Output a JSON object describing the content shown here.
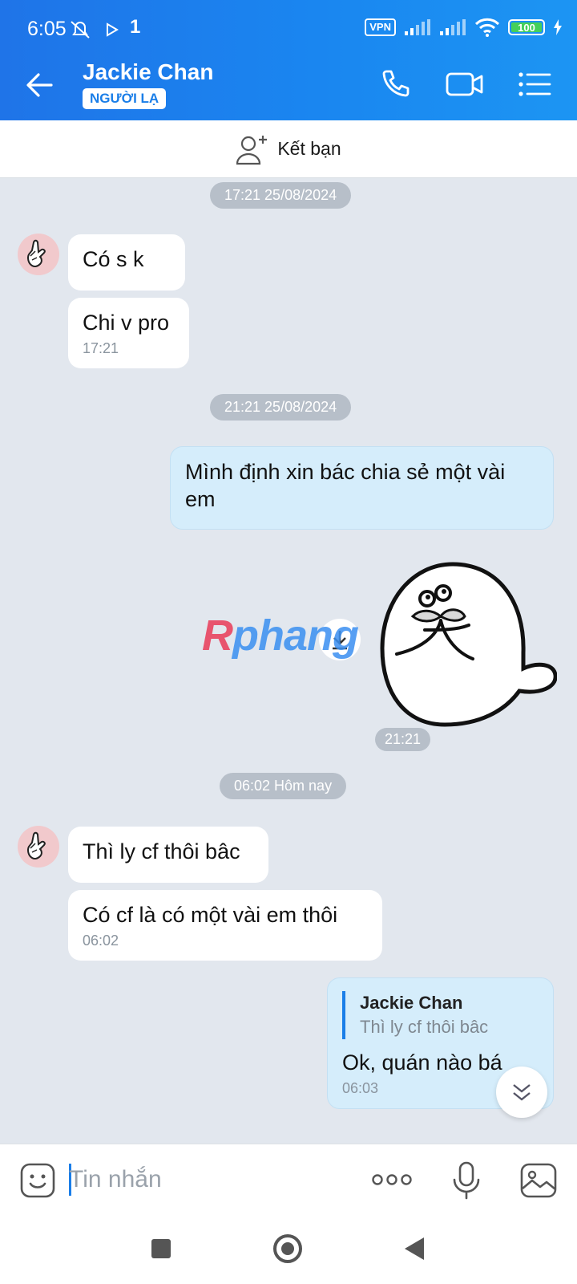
{
  "status_bar": {
    "time": "6:05",
    "extra": "1",
    "vpn": "VPN",
    "battery": "100"
  },
  "header": {
    "contact_name": "Jackie Chan",
    "badge": "NGƯỜI LẠ"
  },
  "add_friend": {
    "label": "Kết bạn"
  },
  "messages": {
    "pill1": "17:21 25/08/2024",
    "m1": "Có s k",
    "m2": "Chi v pro",
    "m2_time": "17:21",
    "pill2": "21:21 25/08/2024",
    "m3": "Mình định xin bác chia sẻ một vài em",
    "sticker_time": "21:21",
    "pill3": "06:02 Hôm nay",
    "m4": "Thì ly cf thôi bâc",
    "m5": "Có cf là có  một vài em thôi",
    "m5_time": "06:02",
    "m6_quote_name": "Jackie Chan",
    "m6_quote_text": "Thì ly cf thôi bâc",
    "m6": "Ok, quán nào bá",
    "m6_time": "06:03"
  },
  "watermark": {
    "r": "R",
    "rest": "phang"
  },
  "input": {
    "placeholder": "Tin nhắn"
  },
  "colors": {
    "accent": "#1a7ee8",
    "chat_bg": "#e2e7ee",
    "out_bubble": "#d5edfb"
  }
}
